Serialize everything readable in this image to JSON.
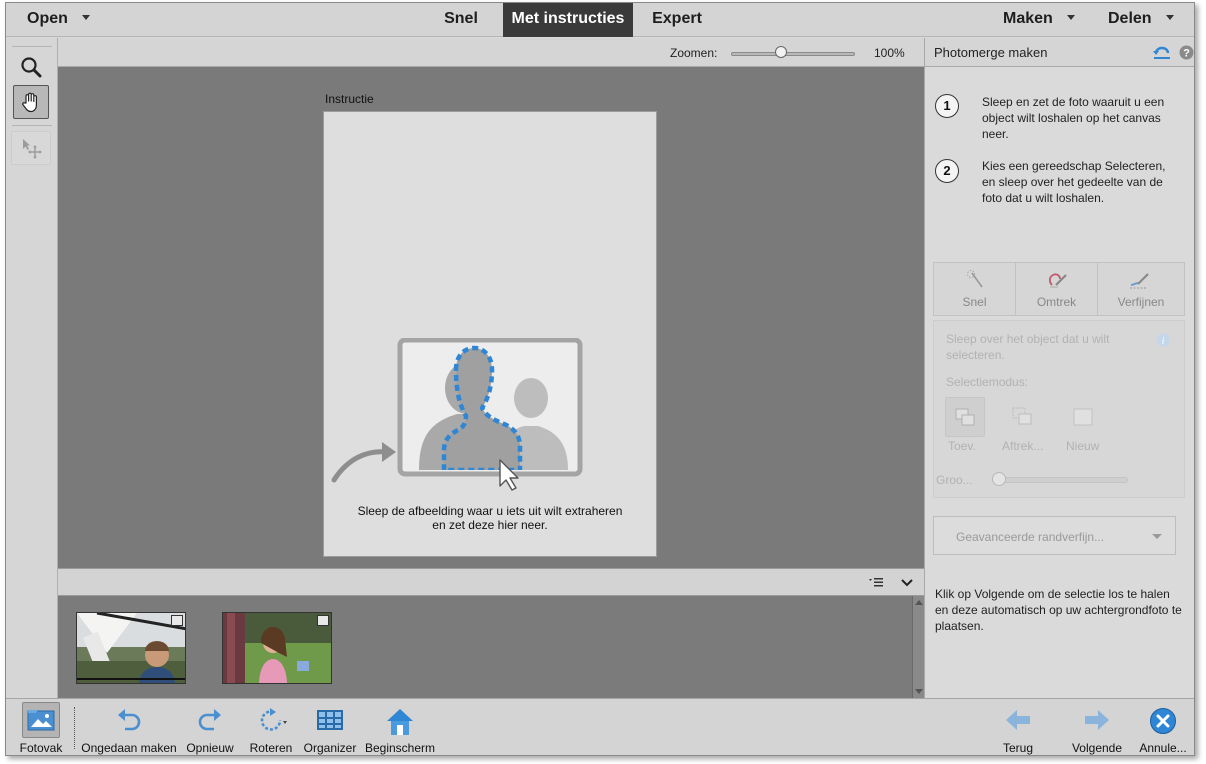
{
  "topbar": {
    "open_label": "Open",
    "modes": [
      "Snel",
      "Met instructies",
      "Expert"
    ],
    "active_mode": "Met instructies",
    "create_label": "Maken",
    "share_label": "Delen"
  },
  "tools": {
    "zoom": "zoom-tool",
    "hand": "hand-tool",
    "move": "move-tool"
  },
  "zoom": {
    "label": "Zoomen:",
    "value": "100%",
    "slider_level": 0.4
  },
  "canvas": {
    "doc_label": "Instructie",
    "drop_text_1": "Sleep de afbeelding waar u iets uit wilt extraheren",
    "drop_text_2": "en zet deze hier neer."
  },
  "panel": {
    "title": "Photomerge maken",
    "steps": [
      {
        "num": "1",
        "text": "Sleep en zet de foto waaruit u een object wilt loshalen op het canvas neer."
      },
      {
        "num": "2",
        "text": "Kies een gereedschap Selecteren, en sleep over het gedeelte van de foto dat u wilt loshalen."
      }
    ],
    "selection_tabs": [
      "Snel",
      "Omtrek",
      "Verfijnen"
    ],
    "hint": "Sleep over het object dat u wilt selecteren.",
    "mode_label": "Selectiemodus:",
    "modes": [
      "Toev.",
      "Aftrek...",
      "Nieuw"
    ],
    "size_label": "Groo...",
    "refine_dropdown": "Geavanceerde randverfijn...",
    "footer": "Klik op Volgende om de selectie los te halen en deze automatisch op uw achtergrondfoto te plaatsen."
  },
  "bottombar": {
    "photobin": "Fotovak",
    "undo": "Ongedaan maken",
    "redo": "Opnieuw",
    "rotate": "Roteren",
    "organizer": "Organizer",
    "home": "Beginscherm",
    "back": "Terug",
    "next": "Volgende",
    "cancel": "Annule..."
  },
  "colors": {
    "accent_blue": "#2e86d4",
    "active_tab": "#3a3a3a"
  }
}
